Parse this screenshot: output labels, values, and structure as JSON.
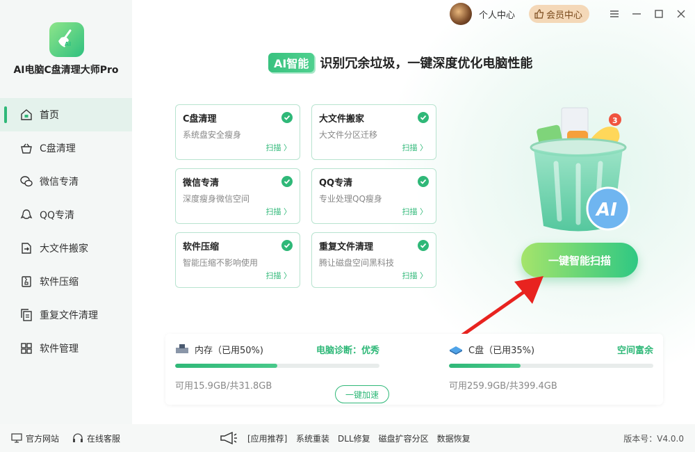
{
  "app": {
    "title": "AI电脑C盘清理大师Pro"
  },
  "sidebar": {
    "items": [
      {
        "label": "首页",
        "icon": "home-icon",
        "active": true
      },
      {
        "label": "C盘清理",
        "icon": "basket-icon"
      },
      {
        "label": "微信专清",
        "icon": "wechat-icon"
      },
      {
        "label": "QQ专清",
        "icon": "qq-icon"
      },
      {
        "label": "大文件搬家",
        "icon": "file-move-icon"
      },
      {
        "label": "软件压缩",
        "icon": "zip-icon"
      },
      {
        "label": "重复文件清理",
        "icon": "duplicate-file-icon"
      },
      {
        "label": "软件管理",
        "icon": "apps-grid-icon"
      }
    ]
  },
  "topbar": {
    "personal": "个人中心",
    "vip": "会员中心"
  },
  "headline": {
    "badge": "AI智能",
    "text": "识别冗余垃圾，一键深度优化电脑性能"
  },
  "cards": [
    {
      "title": "C盘清理",
      "desc": "系统盘安全瘦身",
      "action": "扫描 〉"
    },
    {
      "title": "大文件搬家",
      "desc": "大文件分区迁移",
      "action": "扫描 〉"
    },
    {
      "title": "微信专清",
      "desc": "深度瘦身微信空间",
      "action": "扫描 〉"
    },
    {
      "title": "QQ专清",
      "desc": "专业处理QQ瘦身",
      "action": "扫描 〉"
    },
    {
      "title": "软件压缩",
      "desc": "智能压缩不影响使用",
      "action": "扫描 〉"
    },
    {
      "title": "重复文件清理",
      "desc": "腾让磁盘空间黑科技",
      "action": "扫描 〉"
    }
  ],
  "scan_button": "一键智能扫描",
  "illustration": {
    "badge_count": "3",
    "ai_label": "AI"
  },
  "memory": {
    "name": "内存（已用50%)",
    "status": "电脑诊断：优秀",
    "used_fraction": 0.5,
    "avail": "可用15.9GB/共31.8GB",
    "button": "一键加速"
  },
  "disk": {
    "name": "C盘（已用35%)",
    "status": "空间富余",
    "used_fraction": 0.35,
    "avail": "可用259.9GB/共399.4GB"
  },
  "footer": {
    "website": "官方网站",
    "support": "在线客服",
    "recommend": "[应用推荐]",
    "apps": [
      "系统重装",
      "DLL修复",
      "磁盘扩容分区",
      "数据恢复"
    ],
    "version": "版本号：V4.0.0"
  },
  "colors": {
    "accent": "#2fb878",
    "vip_bg": "#f4d8b8",
    "arrow": "#e8231f"
  }
}
